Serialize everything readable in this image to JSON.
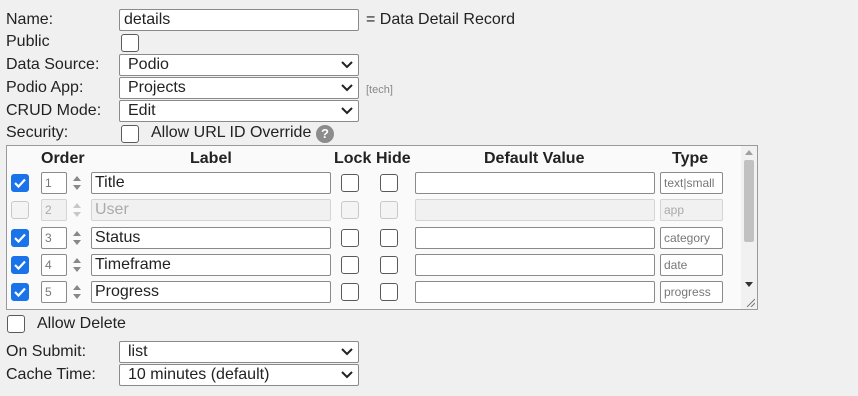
{
  "form": {
    "name_label": "Name:",
    "name_value": "details",
    "name_suffix": "= Data Detail Record",
    "public_label": "Public",
    "data_source_label": "Data Source:",
    "data_source_value": "Podio",
    "podio_app_label": "Podio App:",
    "podio_app_value": "Projects",
    "podio_app_tag": "[tech]",
    "crud_mode_label": "CRUD Mode:",
    "crud_mode_value": "Edit",
    "security_label": "Security:",
    "allow_url_id_label": "Allow URL ID Override",
    "help_icon_text": "?",
    "allow_delete_label": "Allow Delete",
    "on_submit_label": "On Submit:",
    "on_submit_value": "list",
    "cache_time_label": "Cache Time:",
    "cache_time_value": "10 minutes (default)"
  },
  "fields_table": {
    "headers": {
      "order": "Order",
      "label": "Label",
      "lock": "Lock",
      "hide": "Hide",
      "default_value": "Default Value",
      "type": "Type"
    },
    "rows": [
      {
        "enabled": true,
        "order": "1",
        "label": "Title",
        "lock": false,
        "hide": false,
        "default_value": "",
        "type": "text|small",
        "disabled": false
      },
      {
        "enabled": false,
        "order": "2",
        "label": "User",
        "lock": false,
        "hide": false,
        "default_value": "",
        "type": "app",
        "disabled": true
      },
      {
        "enabled": true,
        "order": "3",
        "label": "Status",
        "lock": false,
        "hide": false,
        "default_value": "",
        "type": "category",
        "disabled": false
      },
      {
        "enabled": true,
        "order": "4",
        "label": "Timeframe",
        "lock": false,
        "hide": false,
        "default_value": "",
        "type": "date",
        "disabled": false
      },
      {
        "enabled": true,
        "order": "5",
        "label": "Progress",
        "lock": false,
        "hide": false,
        "default_value": "",
        "type": "progress",
        "disabled": false
      }
    ]
  },
  "colors": {
    "checkbox_checked": "#1a73e8",
    "background": "#f0f0f0"
  }
}
